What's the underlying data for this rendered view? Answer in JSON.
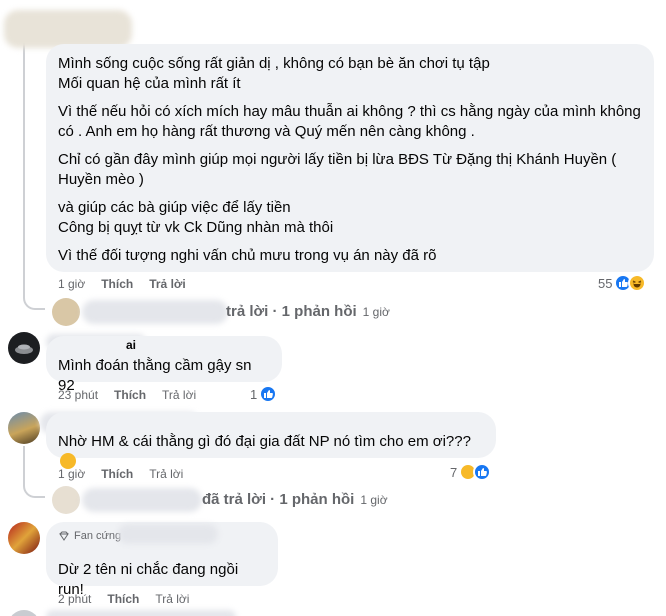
{
  "comment1": {
    "lines": [
      "Mình sống cuộc sống rất giản dị , không có bạn bè ăn chơi tụ tập",
      "Mối quan hệ của mình rất ít",
      "Vì thế nếu hỏi có xích mích hay mâu thuẫn ai không ? thì cs hằng ngày của mình không",
      "có . Anh em họ hàng rất thương và Quý mến nên càng không .",
      "Chỉ có gần đây mình giúp mọi người lấy tiền bị lừa BĐS Từ Đặng thị Khánh Huyền (",
      "Huyền mèo )",
      "và giúp các bà giúp việc để lấy tiền",
      "Công bị quỵt từ vk Ck Dũng nhàn mà thôi",
      "Vì thế đối tượng nghi vấn chủ mưu trong vụ án này đã rõ"
    ],
    "time": "1 giờ",
    "like": "Thích",
    "reply": "Trả lời",
    "reaction_count": "55",
    "replies_summary": "trả lời · 1 phản hồi",
    "replies_time": "1 giờ"
  },
  "comment2": {
    "author_fragment": "ai",
    "text": "Mình đoán thằng cầm gậy sn 92",
    "time": "23 phút",
    "like": "Thích",
    "reply": "Trả lời",
    "reaction_count": "1"
  },
  "comment3": {
    "text": "Nhờ HM & cái thằng gì đó đại gia đất NP nó tìm cho em ơi???",
    "time": "1 giờ",
    "like": "Thích",
    "reply": "Trả lời",
    "reaction_count": "7",
    "replies_summary": "đã trả lời · 1 phản hồi",
    "replies_time": "1 giờ"
  },
  "comment4": {
    "badge": "Fan cứng",
    "text": "Dừ 2 tên ni chắc đang ngồi run!",
    "time": "2 phút",
    "like": "Thích",
    "reply": "Trả lời"
  },
  "colors": {
    "bubble": "#f0f2f5",
    "like_blue": "#1877f2",
    "haha_yellow": "#f7b928",
    "meta_gray": "#65676b",
    "thread_line": "#ced0d4"
  },
  "icons": [
    "like-reaction-icon",
    "haha-reaction-icon",
    "fan-badge-icon",
    "reply-arrow-icon"
  ]
}
